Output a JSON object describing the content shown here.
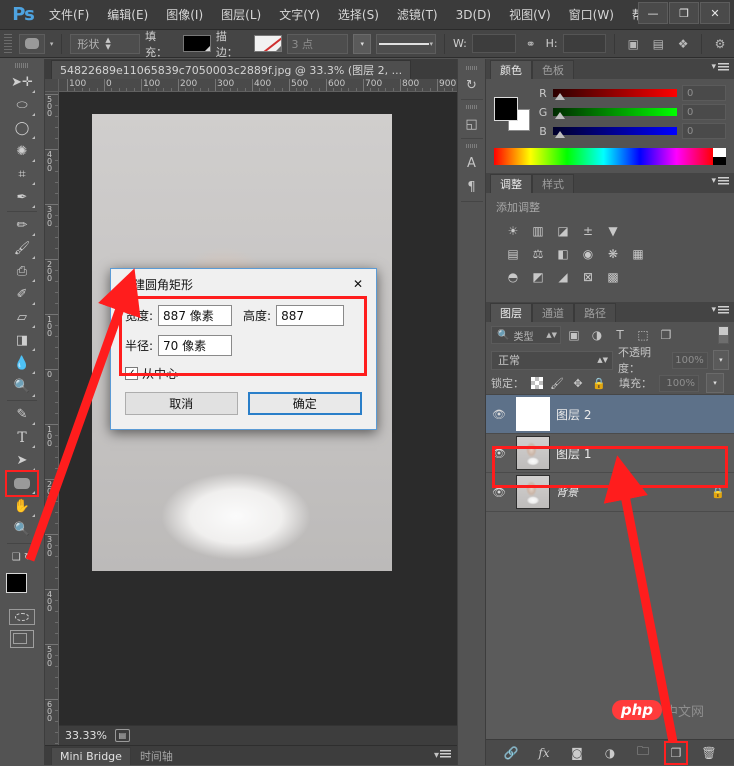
{
  "app": {
    "logo": "Ps",
    "title_truncated": "帮"
  },
  "menubar": {
    "items": [
      "文件(F)",
      "编辑(E)",
      "图像(I)",
      "图层(L)",
      "文字(Y)",
      "选择(S)",
      "滤镜(T)",
      "3D(D)",
      "视图(V)",
      "窗口(W)",
      "帮"
    ],
    "window_controls": {
      "minimize": "—",
      "maximize": "❐",
      "close": "✕"
    }
  },
  "options_bar": {
    "shape_mode": "形状",
    "fill_label": "填充：",
    "stroke_label": "描边：",
    "stroke_width": "3 点",
    "w_label": "W:",
    "h_label": "H:",
    "w_value": "",
    "h_value": "",
    "link_icon": "link-icon",
    "align_icon": "align-icon",
    "path_ops_icon": "path-operations-icon",
    "arrange_icon": "arrange-icon",
    "gear_icon": "gear-icon"
  },
  "toolbox": {
    "tools": [
      {
        "name": "move-tool",
        "glyph": "✛"
      },
      {
        "name": "marquee-tool",
        "glyph": "▭"
      },
      {
        "name": "lasso-tool",
        "glyph": "◯"
      },
      {
        "name": "quick-selection-tool",
        "glyph": "✺"
      },
      {
        "name": "crop-tool",
        "glyph": "⊹"
      },
      {
        "name": "eyedropper-tool",
        "glyph": "✒"
      },
      {
        "name": "healing-brush-tool",
        "glyph": "✏"
      },
      {
        "name": "brush-tool",
        "glyph": "🖌"
      },
      {
        "name": "clone-stamp-tool",
        "glyph": "⎙"
      },
      {
        "name": "history-brush-tool",
        "glyph": "✐"
      },
      {
        "name": "eraser-tool",
        "glyph": "▱"
      },
      {
        "name": "gradient-tool",
        "glyph": "◨"
      },
      {
        "name": "blur-tool",
        "glyph": "💧"
      },
      {
        "name": "dodge-tool",
        "glyph": "🔍"
      },
      {
        "name": "pen-tool",
        "glyph": "✎"
      },
      {
        "name": "type-tool",
        "glyph": "T"
      },
      {
        "name": "path-selection-tool",
        "glyph": "➤"
      },
      {
        "name": "rounded-rectangle-tool",
        "glyph": "▭",
        "selected": true
      },
      {
        "name": "hand-tool",
        "glyph": "✋"
      },
      {
        "name": "zoom-tool",
        "glyph": "🔍"
      }
    ],
    "foreground_color": "#000000",
    "background_color": "#ffffff"
  },
  "document": {
    "tab_title": "54822689e11065839c7050003c2889f.jpg @ 33.3% (图层 2, ...",
    "close_glyph": "✕",
    "zoom_status": "33.33%",
    "ruler_h_labels": [
      "100",
      "0",
      "100",
      "200",
      "300",
      "400",
      "500",
      "600",
      "700",
      "800",
      "900"
    ],
    "ruler_v_labels": [
      "500",
      "400",
      "300",
      "200",
      "100",
      "0",
      "100",
      "200",
      "300",
      "400",
      "500",
      "600"
    ]
  },
  "bottom_panel": {
    "tabs": [
      "Mini Bridge",
      "时间轴"
    ]
  },
  "icon_dock": {
    "items": [
      {
        "name": "history-icon",
        "glyph": "↻"
      },
      {
        "name": "3d-icon",
        "glyph": "◱"
      },
      {
        "name": "character-icon",
        "glyph": "A"
      },
      {
        "name": "paragraph-icon",
        "glyph": "¶"
      }
    ]
  },
  "color_panel": {
    "tabs": [
      {
        "label": "颜色",
        "active": true
      },
      {
        "label": "色板",
        "active": false
      }
    ],
    "channels": [
      {
        "label": "R",
        "value": "0",
        "from": "#2a0000",
        "to": "#ff0000"
      },
      {
        "label": "G",
        "value": "0",
        "from": "#002a00",
        "to": "#00ff00"
      },
      {
        "label": "B",
        "value": "0",
        "from": "#00002a",
        "to": "#0000ff"
      }
    ]
  },
  "adjustments_panel": {
    "tabs": [
      {
        "label": "调整",
        "active": true
      },
      {
        "label": "样式",
        "active": false
      }
    ],
    "heading": "添加调整",
    "rows": [
      [
        {
          "name": "brightness-contrast-icon",
          "glyph": "☀"
        },
        {
          "name": "levels-icon",
          "glyph": "▥"
        },
        {
          "name": "curves-icon",
          "glyph": "◪"
        },
        {
          "name": "exposure-icon",
          "glyph": "±"
        },
        {
          "name": "vibrance-icon",
          "glyph": "▼"
        }
      ],
      [
        {
          "name": "hue-saturation-icon",
          "glyph": "▤"
        },
        {
          "name": "color-balance-icon",
          "glyph": "⚖"
        },
        {
          "name": "black-white-icon",
          "glyph": "◧"
        },
        {
          "name": "photo-filter-icon",
          "glyph": "◉"
        },
        {
          "name": "channel-mixer-icon",
          "glyph": "❋"
        },
        {
          "name": "color-lookup-icon",
          "glyph": "▦"
        }
      ],
      [
        {
          "name": "invert-icon",
          "glyph": "◓"
        },
        {
          "name": "posterize-icon",
          "glyph": "◩"
        },
        {
          "name": "threshold-icon",
          "glyph": "◢"
        },
        {
          "name": "selective-color-icon",
          "glyph": "⊠"
        },
        {
          "name": "gradient-map-icon",
          "glyph": "▩"
        }
      ]
    ]
  },
  "layers_panel": {
    "tabs": [
      {
        "label": "图层",
        "active": true
      },
      {
        "label": "通道",
        "active": false
      },
      {
        "label": "路径",
        "active": false
      }
    ],
    "filter": {
      "search_icon": "search-icon",
      "type_label": "类型"
    },
    "filter_icons": [
      {
        "name": "filter-pixel-icon",
        "glyph": "▣"
      },
      {
        "name": "filter-adjustment-icon",
        "glyph": "◑"
      },
      {
        "name": "filter-type-icon",
        "glyph": "T"
      },
      {
        "name": "filter-shape-icon",
        "glyph": "⬚"
      },
      {
        "name": "filter-smart-object-icon",
        "glyph": "❐"
      }
    ],
    "blend_mode": "正常",
    "opacity_label": "不透明度：",
    "opacity_value": "100%",
    "lock_label": "锁定：",
    "lock_icons": [
      {
        "name": "lock-transparency-icon",
        "glyph": "▩"
      },
      {
        "name": "lock-image-icon",
        "glyph": "🖌"
      },
      {
        "name": "lock-position-icon",
        "glyph": "✥"
      },
      {
        "name": "lock-all-icon",
        "glyph": "🔒"
      }
    ],
    "fill_label": "填充：",
    "fill_value": "100%",
    "layers": [
      {
        "name": "图层 2",
        "visible": true,
        "selected": true,
        "thumb": "checker",
        "locked": false
      },
      {
        "name": "图层 1",
        "visible": true,
        "selected": false,
        "thumb": "photo",
        "locked": false
      },
      {
        "name": "背景",
        "visible": true,
        "selected": false,
        "thumb": "photo",
        "locked": true,
        "italic": true
      }
    ],
    "bottom_icons": [
      {
        "name": "link-layers-icon",
        "glyph": "🔗",
        "highlight": false
      },
      {
        "name": "layer-style-fx-icon",
        "glyph": "fx",
        "highlight": false
      },
      {
        "name": "add-layer-mask-icon",
        "glyph": "◙",
        "highlight": false
      },
      {
        "name": "new-adjustment-layer-icon",
        "glyph": "◑",
        "highlight": false
      },
      {
        "name": "new-group-icon",
        "glyph": "🗀",
        "highlight": false
      },
      {
        "name": "new-layer-icon",
        "glyph": "❐",
        "highlight": true
      },
      {
        "name": "delete-layer-icon",
        "glyph": "🗑",
        "highlight": false
      }
    ]
  },
  "dialog": {
    "title": "创建圆角矩形",
    "close_glyph": "✕",
    "fields": [
      {
        "label": "宽度:",
        "value": "887 像素",
        "name": "width-input"
      },
      {
        "label": "高度:",
        "value": "887",
        "name": "height-input"
      },
      {
        "label": "半径:",
        "value": "70 像素",
        "name": "radius-input"
      }
    ],
    "checkbox": {
      "label": "从中心",
      "checked": true,
      "mark": "✓"
    },
    "buttons": {
      "cancel": "取消",
      "ok": "确定"
    }
  },
  "watermark": {
    "php": "php",
    "cn": "中文网"
  },
  "annotation": {
    "color": "#ff1d1d",
    "marker_count": 3
  }
}
